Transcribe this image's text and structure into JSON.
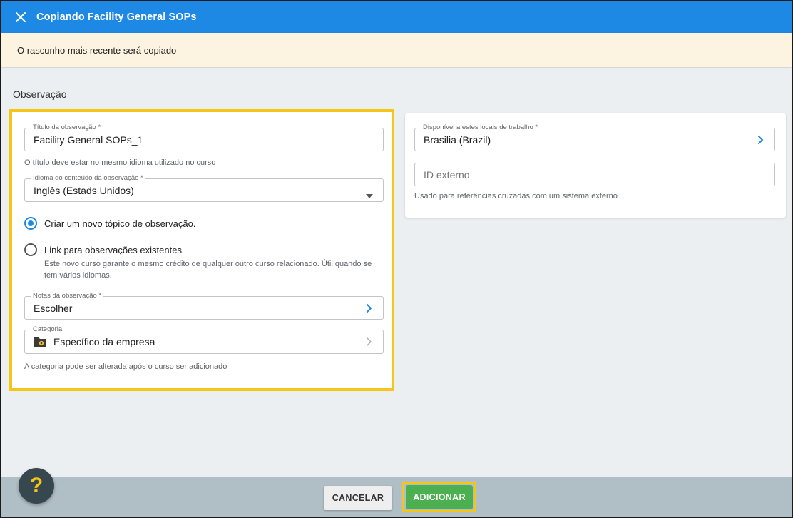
{
  "header": {
    "title": "Copiando Facility General SOPs"
  },
  "banner": {
    "text": "O rascunho mais recente será copiado"
  },
  "section": {
    "title": "Observação"
  },
  "form": {
    "title_field": {
      "label": "Título da observação *",
      "value": "Facility General SOPs_1",
      "helper": "O título deve estar no mesmo idioma utilizado no curso"
    },
    "language_field": {
      "label": "Idioma do conteúdo da observação *",
      "value": "Inglês (Estads Unidos)"
    },
    "radio_new": {
      "label": "Criar um novo tópico de observação."
    },
    "radio_link": {
      "label": "Link para observações existentes",
      "description": "Este novo curso garante o mesmo crédito de qualquer outro curso relacionado. Útil quando se tem vários idiomas."
    },
    "notes_field": {
      "label": "Notas da observação *",
      "value": "Escolher"
    },
    "category_field": {
      "label": "Categoria",
      "value": "Específico da empresa",
      "helper": "A categoria pode ser alterada após o curso ser adicionado"
    }
  },
  "right": {
    "locations_field": {
      "label": "Disponível a estes locais de trabalho *",
      "value": "Brasilia (Brazil)"
    },
    "external_id": {
      "placeholder": "ID externo",
      "helper": "Usado para referências cruzadas com um sistema externo"
    }
  },
  "footer": {
    "cancel_label": "CANCELAR",
    "add_label": "ADICIONAR",
    "help_symbol": "?"
  },
  "colors": {
    "primary": "#1e88e5",
    "highlight": "#f5c518",
    "add_button": "#4caf50",
    "banner": "#fdf3e1"
  }
}
